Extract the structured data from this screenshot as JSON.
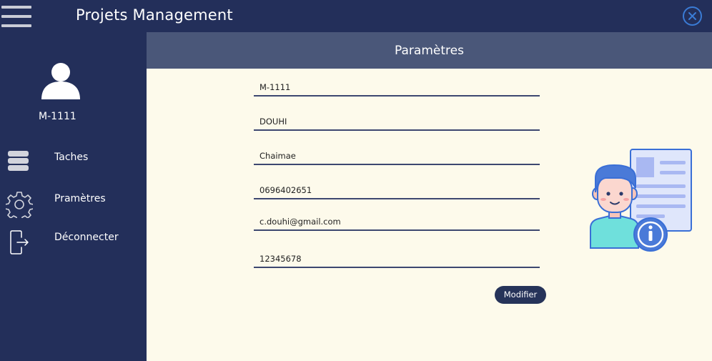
{
  "app": {
    "title": "Projets Management"
  },
  "sidebar": {
    "user_id": "M-1111",
    "items": [
      {
        "label": "Taches",
        "icon": "stack-icon"
      },
      {
        "label": "Pramètres",
        "icon": "gear-icon"
      },
      {
        "label": "Déconnecter",
        "icon": "logout-icon"
      }
    ]
  },
  "main": {
    "title": "Paramètres",
    "fields": [
      {
        "value": "M-1111"
      },
      {
        "value": "DOUHI"
      },
      {
        "value": "Chaimae"
      },
      {
        "value": "0696402651"
      },
      {
        "value": "c.douhi@gmail.com"
      },
      {
        "value": "12345678"
      }
    ],
    "submit_label": "Modifier"
  },
  "colors": {
    "sidebar_bg": "#232f5a",
    "header_bg": "#4a5779",
    "content_bg": "#fdfaeb",
    "accent": "#3a7bd5"
  }
}
